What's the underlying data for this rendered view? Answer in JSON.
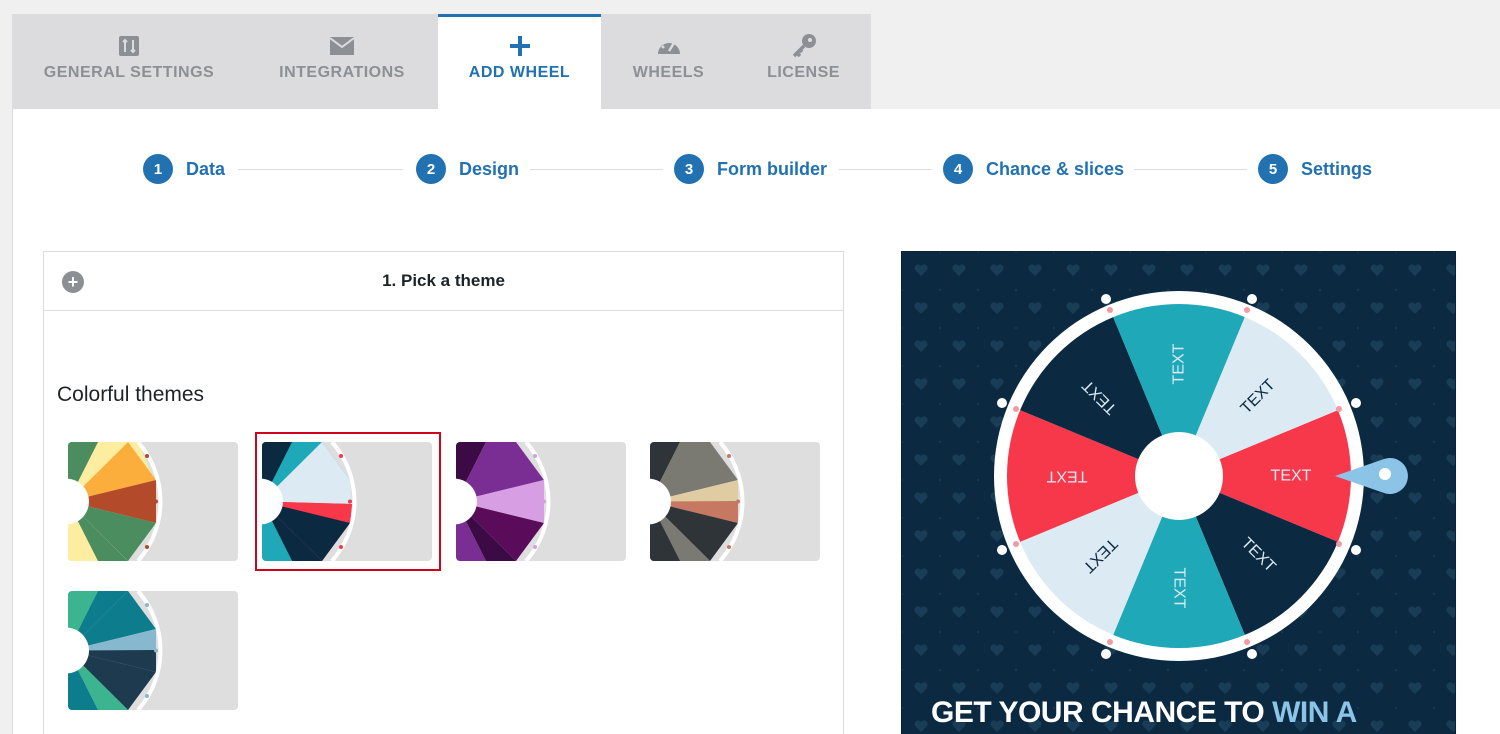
{
  "tabs": [
    {
      "label": "GENERAL SETTINGS",
      "icon": "sliders-icon"
    },
    {
      "label": "INTEGRATIONS",
      "icon": "envelope-icon"
    },
    {
      "label": "ADD WHEEL",
      "icon": "plus-icon",
      "active": true
    },
    {
      "label": "WHEELS",
      "icon": "dashboard-icon"
    },
    {
      "label": "LICENSE",
      "icon": "key-icon"
    }
  ],
  "steps": [
    {
      "num": "1",
      "label": "Data"
    },
    {
      "num": "2",
      "label": "Design"
    },
    {
      "num": "3",
      "label": "Form builder"
    },
    {
      "num": "4",
      "label": "Chance & slices"
    },
    {
      "num": "5",
      "label": "Settings"
    }
  ],
  "theme_section": {
    "title": "1. Pick a theme",
    "group_label": "Colorful themes",
    "selected_index": 1
  },
  "preview": {
    "slice_label": "TEXT",
    "headline_part1": "GET YOUR CHANCE TO",
    "headline_part2": "WIN A"
  },
  "colors": {
    "accent": "#2271b1",
    "selected_border": "#d0021b",
    "preview_bg": "#0b2940",
    "wheel_dark": "#0b2940",
    "wheel_teal": "#1fa8b8",
    "wheel_light": "#dbeaf3",
    "wheel_red": "#f7374a"
  }
}
